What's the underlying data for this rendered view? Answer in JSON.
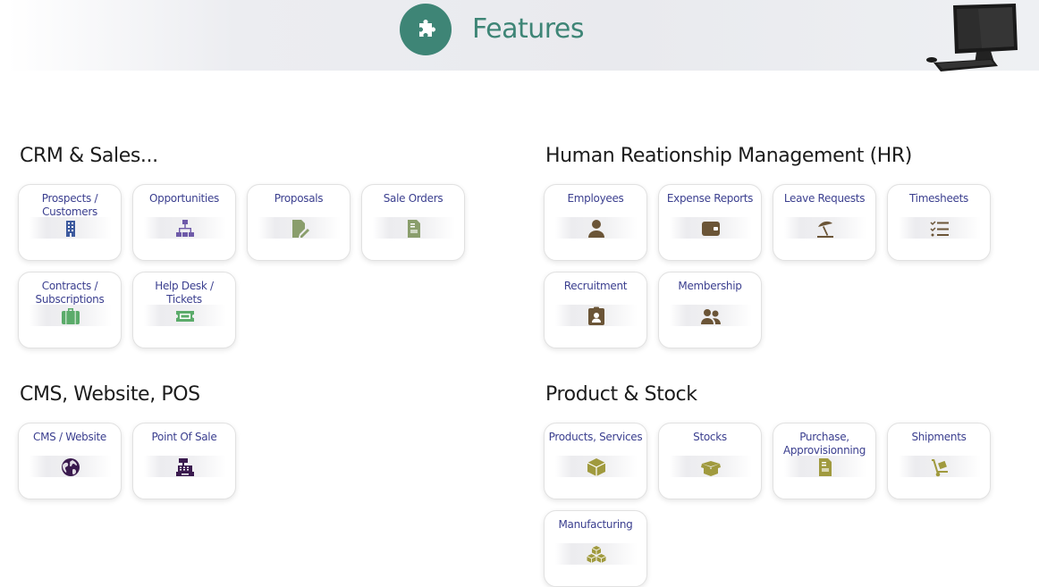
{
  "header": {
    "title": "Features",
    "accent": "#3e8576"
  },
  "sections": {
    "crm": {
      "title": "CRM & Sales...",
      "items": [
        {
          "label": "Prospects / Customers",
          "icon": "building-icon",
          "color": "#3d5a9e"
        },
        {
          "label": "Opportunities",
          "icon": "sitemap-icon",
          "color": "#6e5aa8"
        },
        {
          "label": "Proposals",
          "icon": "file-signature-icon",
          "color": "#8a9e6c"
        },
        {
          "label": "Sale Orders",
          "icon": "file-invoice-icon",
          "color": "#8a9e6c"
        },
        {
          "label": "Contracts / Subscriptions",
          "icon": "suitcase-icon",
          "color": "#5bab6a"
        },
        {
          "label": "Help Desk / Tickets",
          "icon": "ticket-icon",
          "color": "#5bab6a"
        }
      ]
    },
    "hr": {
      "title": "Human Reationship Management (HR)",
      "items": [
        {
          "label": "Employees",
          "icon": "user-icon",
          "color": "#6b5537"
        },
        {
          "label": "Expense Reports",
          "icon": "wallet-icon",
          "color": "#6b5537"
        },
        {
          "label": "Leave Requests",
          "icon": "umbrella-beach-icon",
          "color": "#6b5537"
        },
        {
          "label": "Timesheets",
          "icon": "tasks-icon",
          "color": "#6b5537"
        },
        {
          "label": "Recruitment",
          "icon": "id-badge-icon",
          "color": "#6b5537"
        },
        {
          "label": "Membership",
          "icon": "users-icon",
          "color": "#6b5537"
        }
      ]
    },
    "cms": {
      "title": "CMS, Website, POS",
      "items": [
        {
          "label": "CMS / Website",
          "icon": "globe-icon",
          "color": "#3a1a4e"
        },
        {
          "label": "Point Of Sale",
          "icon": "cash-register-icon",
          "color": "#3a1a4e"
        }
      ]
    },
    "product": {
      "title": "Product & Stock",
      "items": [
        {
          "label": "Products, Services",
          "icon": "cube-icon",
          "color": "#a09a3e"
        },
        {
          "label": "Stocks",
          "icon": "box-open-icon",
          "color": "#a09a3e"
        },
        {
          "label": "Purchase, Approvisionning",
          "icon": "file-invoice-icon",
          "color": "#a09a3e"
        },
        {
          "label": "Shipments",
          "icon": "dolly-icon",
          "color": "#a09a3e"
        },
        {
          "label": "Manufacturing",
          "icon": "cubes-icon",
          "color": "#a09a3e"
        }
      ]
    }
  }
}
